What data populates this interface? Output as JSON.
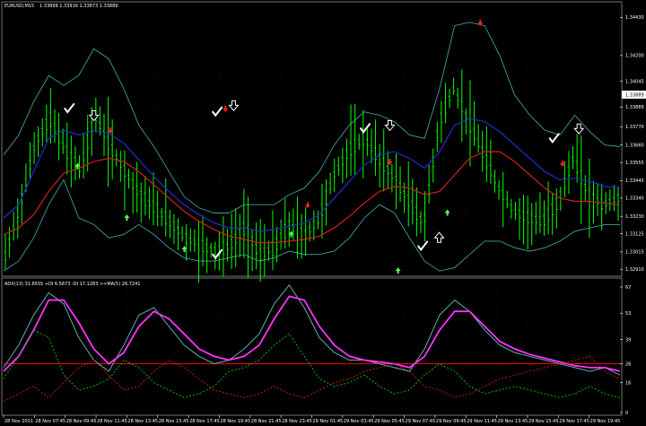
{
  "header": {
    "symbol_label": "EURUSD,M15",
    "ohlc_label": "1.33899 1.33916 1.33873 1.33889"
  },
  "indicator_header": {
    "label": "ADX(13) 31.6555 +DI 6.5673 -DI 17.1283 >>MA(5) 26.7241"
  },
  "colors": {
    "background": "#000000",
    "grid": "#ffffff",
    "candle": "#00ff00",
    "bollinger": "#3f9f9f",
    "ma_fast": "#1f2fcf",
    "ma_slow": "#cf1f1f",
    "adx": "#5fafaf",
    "adx_ma": "#ff33ff",
    "plus_di": "#00cc00",
    "minus_di": "#cc2222",
    "level": "#ff0000",
    "arrow_up": "#55ff55",
    "arrow_down": "#ff2020",
    "check": "#ffffff"
  },
  "chart_data": [
    {
      "type": "line",
      "panel": "price",
      "ylim": [
        1.3289,
        1.3447
      ],
      "x": [
        "28 Nov 2011",
        "28 Nov 07:45",
        "28 Nov 09:45",
        "28 Nov 11:45",
        "28 Nov 13:45",
        "28 Nov 15:45",
        "28 Nov 17:45",
        "28 Nov 19:45",
        "28 Nov 21:45",
        "28 Nov 23:45",
        "29 Nov 01:45",
        "29 Nov 03:45",
        "29 Nov 05:45",
        "29 Nov 07:45",
        "29 Nov 09:45",
        "29 Nov 11:45",
        "29 Nov 13:45",
        "29 Nov 15:45",
        "29 Nov 17:45",
        "29 Nov 19:45"
      ],
      "y_ticks": [
        "1.34430",
        "1.34200",
        "1.34045",
        "1.33889",
        "1.33770",
        "1.33660",
        "1.33555",
        "1.33445",
        "1.33340",
        "1.33230",
        "1.33125",
        "1.33015",
        "1.32910",
        "1.32800",
        "1.32695"
      ],
      "current_price": "1.33889",
      "series": [
        {
          "role": "close",
          "values": [
            1.3299,
            1.333,
            1.3367,
            1.3382,
            1.3363,
            1.3352,
            1.3384,
            1.3365,
            1.335,
            1.3336,
            1.3328,
            1.332,
            1.331,
            1.3306,
            1.3302,
            1.3305,
            1.3316,
            1.33,
            1.3304,
            1.3318,
            1.3311,
            1.3322,
            1.3348,
            1.3363,
            1.337,
            1.3358,
            1.3346,
            1.3332,
            1.3318,
            1.3379,
            1.34,
            1.338,
            1.336,
            1.334,
            1.3326,
            1.3322,
            1.332,
            1.3332,
            1.3358,
            1.3336,
            1.333,
            1.3334
          ]
        },
        {
          "role": "bollinger-upper",
          "values": [
            1.336,
            1.3372,
            1.3392,
            1.3408,
            1.3402,
            1.3408,
            1.3424,
            1.3418,
            1.34,
            1.3378,
            1.3365,
            1.335,
            1.3335,
            1.3328,
            1.3325,
            1.3325,
            1.333,
            1.333,
            1.333,
            1.3336,
            1.334,
            1.335,
            1.3366,
            1.3378,
            1.3386,
            1.3384,
            1.338,
            1.3372,
            1.337,
            1.34,
            1.3438,
            1.344,
            1.3438,
            1.342,
            1.3396,
            1.3384,
            1.3375,
            1.3372,
            1.3384,
            1.3374,
            1.3366,
            1.3365
          ]
        },
        {
          "role": "ma-fast",
          "values": [
            1.3322,
            1.333,
            1.335,
            1.337,
            1.3375,
            1.3372,
            1.3375,
            1.3373,
            1.3367,
            1.3357,
            1.3347,
            1.3338,
            1.333,
            1.3324,
            1.3319,
            1.3316,
            1.3316,
            1.3314,
            1.3315,
            1.3317,
            1.3319,
            1.3324,
            1.3334,
            1.3344,
            1.3354,
            1.336,
            1.3362,
            1.3358,
            1.3352,
            1.3362,
            1.3378,
            1.3382,
            1.338,
            1.3374,
            1.3366,
            1.3358,
            1.335,
            1.3345,
            1.3346,
            1.3344,
            1.3341,
            1.334
          ]
        },
        {
          "role": "ma-slow",
          "values": [
            1.3312,
            1.3316,
            1.3324,
            1.3338,
            1.3349,
            1.3352,
            1.3356,
            1.3358,
            1.3356,
            1.335,
            1.3342,
            1.3334,
            1.3326,
            1.332,
            1.3315,
            1.3311,
            1.3309,
            1.3307,
            1.3307,
            1.3308,
            1.3309,
            1.3311,
            1.3316,
            1.3323,
            1.3331,
            1.3338,
            1.3341,
            1.334,
            1.3336,
            1.3338,
            1.3348,
            1.3358,
            1.3362,
            1.3362,
            1.3356,
            1.3348,
            1.334,
            1.3334,
            1.3332,
            1.3332,
            1.3331,
            1.333
          ]
        },
        {
          "role": "bollinger-lower",
          "values": [
            1.329,
            1.3296,
            1.331,
            1.333,
            1.3345,
            1.3322,
            1.3318,
            1.331,
            1.3312,
            1.3318,
            1.3312,
            1.3304,
            1.3298,
            1.3296,
            1.3296,
            1.3298,
            1.33,
            1.3296,
            1.3298,
            1.3302,
            1.33,
            1.33,
            1.3302,
            1.331,
            1.3322,
            1.333,
            1.3325,
            1.331,
            1.3296,
            1.329,
            1.3292,
            1.33,
            1.3308,
            1.3308,
            1.3304,
            1.3302,
            1.3304,
            1.3308,
            1.3314,
            1.3316,
            1.3318,
            1.3318
          ]
        }
      ],
      "signals": {
        "buy_arrows": [
          [
            9,
            1.3353
          ],
          [
            15,
            1.3322
          ],
          [
            22,
            1.3303
          ],
          [
            35,
            1.3312
          ],
          [
            48,
            1.329
          ],
          [
            54,
            1.3325
          ]
        ],
        "sell_arrows": [
          [
            13,
            1.3375
          ],
          [
            27,
            1.3388
          ],
          [
            37,
            1.333
          ],
          [
            47,
            1.3356
          ],
          [
            58,
            1.344
          ],
          [
            68,
            1.3355
          ]
        ],
        "open_down_arrows": [
          [
            11,
            1.3384
          ],
          [
            28,
            1.339
          ],
          [
            47,
            1.3378
          ],
          [
            70,
            1.3376
          ]
        ],
        "open_up_arrows": [
          [
            53,
            1.331
          ]
        ],
        "checks": [
          [
            8,
            1.3388
          ],
          [
            26,
            1.3386
          ],
          [
            44,
            1.3376
          ],
          [
            51,
            1.3305
          ],
          [
            67,
            1.337
          ],
          [
            26,
            1.33
          ]
        ]
      }
    },
    {
      "type": "line",
      "panel": "indicator",
      "ylim": [
        0,
        67
      ],
      "y_ticks": [
        "67",
        "53",
        "39",
        "26",
        "16",
        "0"
      ],
      "level": 26,
      "series": [
        {
          "role": "adx",
          "values": [
            24,
            36,
            52,
            64,
            58,
            40,
            28,
            22,
            36,
            52,
            56,
            46,
            36,
            30,
            26,
            28,
            34,
            42,
            58,
            68,
            56,
            40,
            32,
            28,
            28,
            26,
            24,
            22,
            34,
            52,
            60,
            54,
            44,
            36,
            32,
            30,
            28,
            26,
            24,
            22,
            24,
            20
          ]
        },
        {
          "role": "adx-ma",
          "values": [
            22,
            30,
            44,
            60,
            60,
            48,
            34,
            26,
            32,
            46,
            54,
            50,
            42,
            34,
            30,
            28,
            30,
            36,
            50,
            62,
            60,
            46,
            36,
            30,
            28,
            27,
            26,
            24,
            30,
            44,
            54,
            54,
            46,
            38,
            34,
            31,
            29,
            27,
            25,
            24,
            24,
            22
          ]
        },
        {
          "role": "plus-di",
          "values": [
            18,
            30,
            44,
            40,
            20,
            12,
            14,
            18,
            28,
            24,
            16,
            12,
            8,
            10,
            14,
            22,
            24,
            28,
            36,
            42,
            30,
            18,
            14,
            16,
            20,
            14,
            10,
            12,
            20,
            26,
            22,
            14,
            10,
            12,
            14,
            12,
            10,
            8,
            10,
            14,
            10,
            8
          ]
        },
        {
          "role": "minus-di",
          "values": [
            6,
            10,
            14,
            8,
            16,
            24,
            28,
            20,
            12,
            14,
            22,
            28,
            24,
            18,
            12,
            10,
            8,
            10,
            14,
            10,
            8,
            12,
            16,
            18,
            22,
            24,
            26,
            22,
            14,
            12,
            8,
            10,
            14,
            18,
            20,
            22,
            24,
            26,
            28,
            30,
            22,
            18
          ]
        }
      ]
    }
  ]
}
